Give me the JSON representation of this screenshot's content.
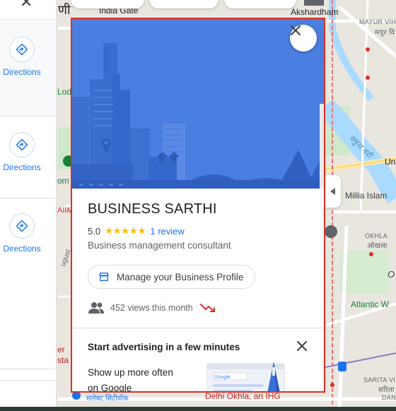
{
  "map": {
    "labels": {
      "india_gate": "India Gate",
      "hindi_fragment": "णी",
      "akshardham": "Akshardham",
      "mayur_vihar": "MAYUR VIH",
      "mayur_vihar_hi": "मयूर वि",
      "yamuna_hi": "यमुना नदी",
      "un": "Un",
      "millia_islam": "Millia Islam",
      "all": "AIIM",
      "okhla": "OKHLA",
      "okhla_hi": "ओखला",
      "atlantic": "Atlantic W",
      "o_fragment": "O",
      "sarita_vihar": "SARITA VI",
      "sarita_vihar_hi": "सरिता वि",
      "dan": "DAN",
      "ug": "ugust",
      "lod": "Lod",
      "om": "om",
      "er": "er",
      "sta": "sta",
      "selected_city": "सलेक्ट सिटीवॉक",
      "delhi_okhla": "Delhi Okhla, an IHG"
    }
  },
  "results": {
    "items": [
      {
        "label": "Directions"
      },
      {
        "label": "Directions"
      },
      {
        "label": "Directions"
      }
    ]
  },
  "card": {
    "business_name": "BUSINESS SARTHI",
    "rating_value": "5.0",
    "stars": "★★★★★",
    "review_link": "1 review",
    "category": "Business management consultant",
    "manage_button": "Manage your Business Profile",
    "views_text": "452 views this month",
    "ad": {
      "title": "Start advertising in a few minutes",
      "body_line1": "Show up more often",
      "body_line2": "on Google",
      "illustration_text": "Google"
    }
  },
  "colors": {
    "accent": "#1a73e8",
    "hero_bg": "#4a7ee0",
    "star": "#fbbc04",
    "card_border": "#d93025",
    "trend": "#d93025"
  }
}
